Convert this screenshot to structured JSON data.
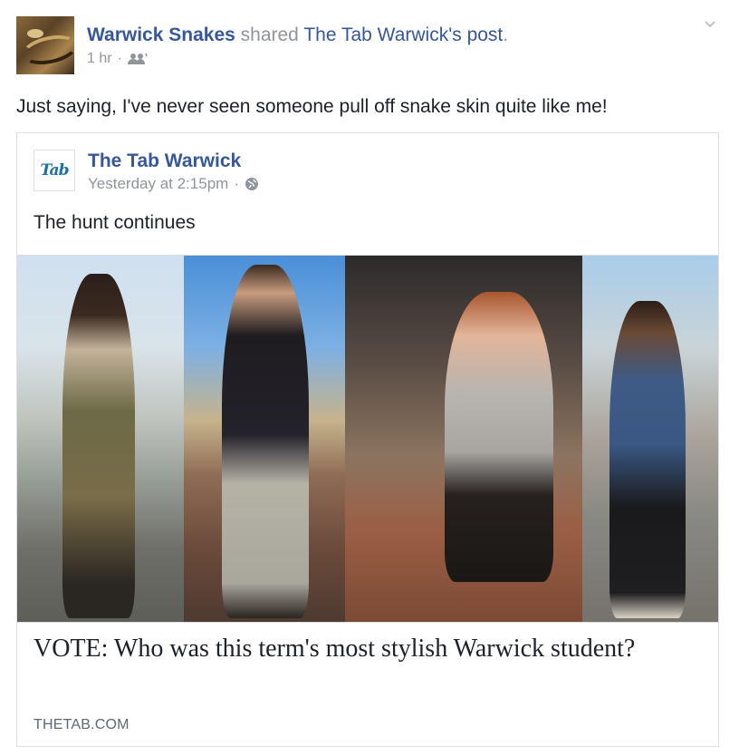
{
  "post": {
    "page_name": "Warwick Snakes",
    "shared_word": "shared",
    "shared_source": "The Tab Warwick",
    "source_suffix": "'s post",
    "period": ".",
    "timestamp": "1 hr",
    "audience_icon": "friends-icon",
    "status_text": "Just saying, I've never seen someone pull off snake skin quite like me!",
    "menu_icon": "chevron-down-icon"
  },
  "shared_post": {
    "author": "The Tab Warwick",
    "logo_text": "Tab",
    "timestamp": "Yesterday at 2:15pm",
    "audience_icon": "globe-icon",
    "text": "The hunt continues",
    "link_title": "VOTE: Who was this term's most stylish Warwick student?",
    "link_domain": "THETAB.COM"
  },
  "colors": {
    "link": "#365899",
    "muted": "#90949c",
    "border": "#dddfe2"
  }
}
